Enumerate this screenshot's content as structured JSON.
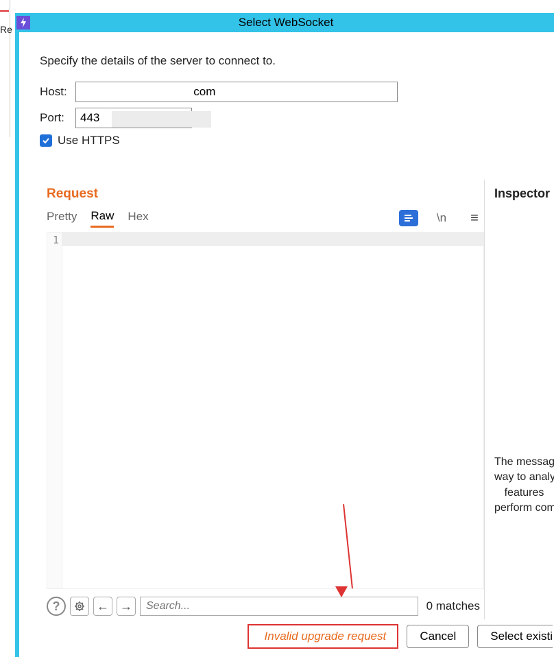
{
  "bg_frag": "Re",
  "title": "Select WebSocket",
  "intro": "Specify the details of the server to connect to.",
  "host": {
    "label": "Host:",
    "value": "                                   com"
  },
  "port": {
    "label": "Port:",
    "value": "443"
  },
  "use_https": {
    "label": "Use HTTPS",
    "checked": true
  },
  "request": {
    "title": "Request",
    "tabs": {
      "pretty": "Pretty",
      "raw": "Raw",
      "hex": "Hex"
    },
    "toolbar": {
      "wrap": "\\n",
      "menu": "≡"
    },
    "gutter_line": "1",
    "search_placeholder": "Search...",
    "matches": "0 matches"
  },
  "inspector": {
    "title": "Inspector",
    "blurb_l1": "The message",
    "blurb_l2": "way to analy",
    "blurb_l3": "features",
    "blurb_l4": "perform com"
  },
  "error": "Invalid upgrade request",
  "buttons": {
    "cancel": "Cancel",
    "select_existing": "Select existi"
  }
}
